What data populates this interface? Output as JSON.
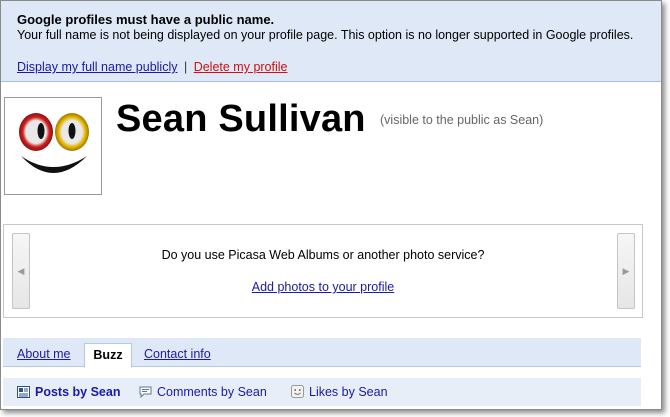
{
  "banner": {
    "title": "Google profiles must have a public name.",
    "message": "Your full name is not being displayed on your profile page. This option is no longer supported in Google profiles.",
    "display_link": "Display my full name publicly",
    "separator": "|",
    "delete_link": "Delete my profile"
  },
  "profile": {
    "name": "Sean Sullivan",
    "visibility_note": "(visible to the public as Sean)"
  },
  "photos": {
    "question": "Do you use Picasa Web Albums or another photo service?",
    "add_link": "Add photos to your profile",
    "prev_arrow": "◀",
    "next_arrow": "▶"
  },
  "tabs": [
    {
      "label": "About me",
      "active": false
    },
    {
      "label": "Buzz",
      "active": true
    },
    {
      "label": "Contact info",
      "active": false
    }
  ],
  "subnav": [
    {
      "label": "Posts by Sean",
      "icon": "posts-icon",
      "active": true
    },
    {
      "label": "Comments by Sean",
      "icon": "comment-icon",
      "active": false
    },
    {
      "label": "Likes by Sean",
      "icon": "smiley-icon",
      "active": false
    }
  ],
  "colors": {
    "banner_bg": "#dfe8f6",
    "link": "#1a1aa8",
    "delete_link": "#cc1111",
    "tab_bar_bg": "#dfe8f6"
  }
}
